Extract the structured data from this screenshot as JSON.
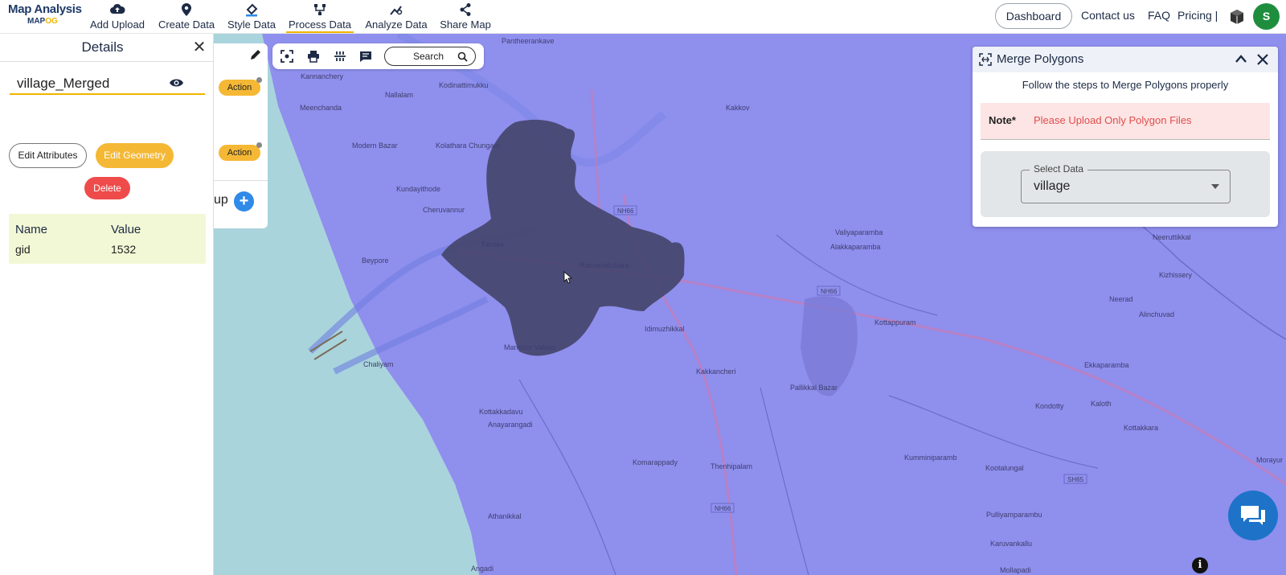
{
  "app": {
    "logo_title": "Map Analysis",
    "logo_sub_a": "MAP",
    "logo_sub_b": "OG"
  },
  "nav": {
    "items": [
      {
        "label": "Add Upload",
        "icon": "cloud-upload-icon"
      },
      {
        "label": "Create Data",
        "icon": "map-pin-icon"
      },
      {
        "label": "Style Data",
        "icon": "paint-bucket-icon"
      },
      {
        "label": "Process Data",
        "icon": "process-nodes-icon",
        "active": true
      },
      {
        "label": "Analyze Data",
        "icon": "analyze-chart-icon"
      },
      {
        "label": "Share Map",
        "icon": "share-icon"
      }
    ],
    "dashboard": "Dashboard",
    "contact": "Contact us",
    "faq": "FAQ",
    "pricing": "Pricing |",
    "avatar_letter": "S"
  },
  "details": {
    "title": "Details",
    "layer_name": "village_Merged",
    "edit_attributes": "Edit Attributes",
    "edit_geometry": "Edit Geometry",
    "delete": "Delete",
    "table": {
      "headers": [
        "Name",
        "Value"
      ],
      "rows": [
        [
          "gid",
          "1532"
        ]
      ]
    }
  },
  "layers_panel": {
    "action_1": "Action",
    "action_2": "Action",
    "group_fragment": "up"
  },
  "toolbar": {
    "search_label": "Search"
  },
  "merge_panel": {
    "title": "Merge Polygons",
    "subtitle": "Follow the steps to Merge Polygons properly",
    "note_label": "Note*",
    "note_text": "Please Upload Only Polygon Files",
    "select_label": "Select Data",
    "select_value": "village"
  },
  "map": {
    "labels": [
      "Pantheerankave",
      "Kannanchery",
      "Kodinattimukku",
      "Nallalam",
      "Meenchanda",
      "Kakkov",
      "Modern Bazar",
      "Kolathara Chungam",
      "Kundayithode",
      "Cheruvannur",
      "Feroke",
      "Beypore",
      "Ramanattukara",
      "Valiyaparamba",
      "Alakkaparamba",
      "Neeruttikkal",
      "Kizhissery",
      "Neerad",
      "Idimuzhikkal",
      "Kottappuram",
      "Alinchuvad",
      "Chaliyam",
      "Mannoor Valavu",
      "Kakkancheri",
      "Pallikkal Bazar",
      "Ekkaparamba",
      "Kondotty",
      "Kaloth",
      "Kottakkadavu",
      "Anayarangadi",
      "Komarappady",
      "Thenhipalam",
      "Kumminiparamb",
      "Kottakkara",
      "Kootalungal",
      "Morayur",
      "Athanikkal",
      "Pulliyamparambu",
      "Karuvankallu",
      "Mollapadi",
      "Angadi"
    ],
    "road_labels": [
      "NH66",
      "NH66",
      "NH66",
      "SH65"
    ],
    "colors": {
      "overlay": "#8f8fee",
      "selected_polygon": "#45456e",
      "sea": "#a9d4dc",
      "accent": "#f5b835"
    }
  }
}
